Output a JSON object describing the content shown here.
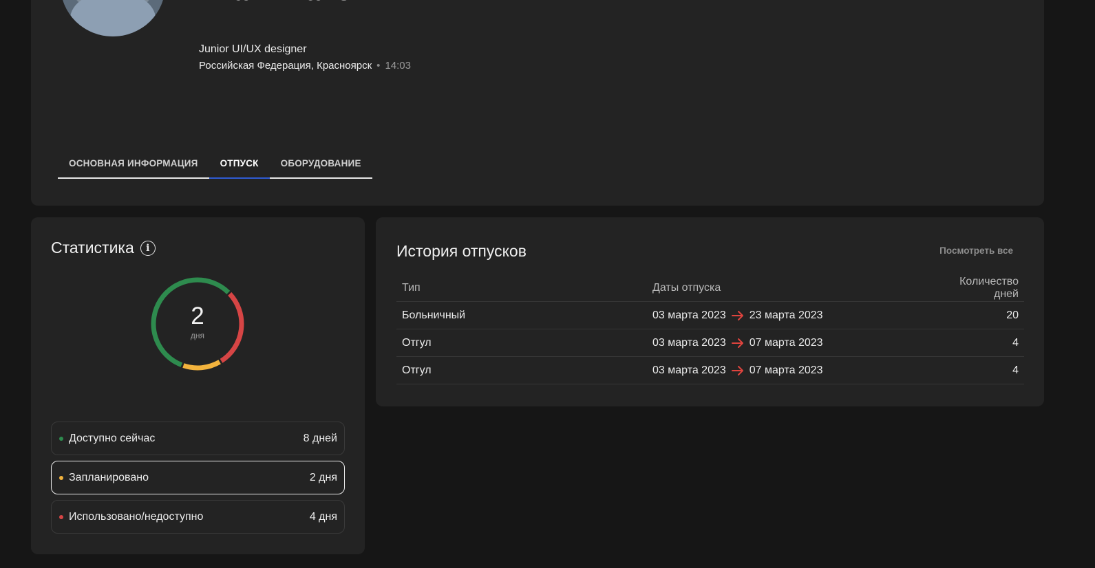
{
  "profile": {
    "name": "Иван Иванович",
    "role": "Junior UI/UX designer",
    "location": "Российская Федерация, Красноярск",
    "separator": "•",
    "local_time": "14:03"
  },
  "tabs": [
    {
      "label": "ОСНОВНАЯ ИНФОРМАЦИЯ",
      "active": false
    },
    {
      "label": "ОТПУСК",
      "active": true
    },
    {
      "label": "ОБОРУДОВАНИЕ",
      "active": false
    }
  ],
  "stats": {
    "title": "Статистика",
    "info_icon": "info-icon",
    "donut": {
      "value": "2",
      "unit": "дня",
      "segments": [
        {
          "name": "available",
          "amount": 8,
          "color": "#2e8b4e"
        },
        {
          "name": "used",
          "amount": 4,
          "color": "#d64545"
        },
        {
          "name": "planned",
          "amount": 2,
          "color": "#f2b33d"
        }
      ]
    },
    "legend": [
      {
        "label": "Доступно сейчас",
        "value": "8 дней",
        "color": "#2e8b4e",
        "selected": false
      },
      {
        "label": "Запланировано",
        "value": "2 дня",
        "color": "#f2b33d",
        "selected": true
      },
      {
        "label": "Использовано/недоступно",
        "value": "4 дня",
        "color": "#d64545",
        "selected": false
      }
    ]
  },
  "history": {
    "title": "История отпусков",
    "view_all": "Посмотреть все",
    "columns": [
      "Тип",
      "Даты отпуска",
      "Количество дней"
    ],
    "arrow_color": "#e0443e",
    "rows": [
      {
        "type": "Больничный",
        "from": "03 марта 2023",
        "to": "23 марта 2023",
        "days": "20"
      },
      {
        "type": "Отгул",
        "from": "03 марта 2023",
        "to": "07 марта 2023",
        "days": "4"
      },
      {
        "type": "Отгул",
        "from": "03 марта 2023",
        "to": "07 марта 2023",
        "days": "4"
      }
    ]
  }
}
